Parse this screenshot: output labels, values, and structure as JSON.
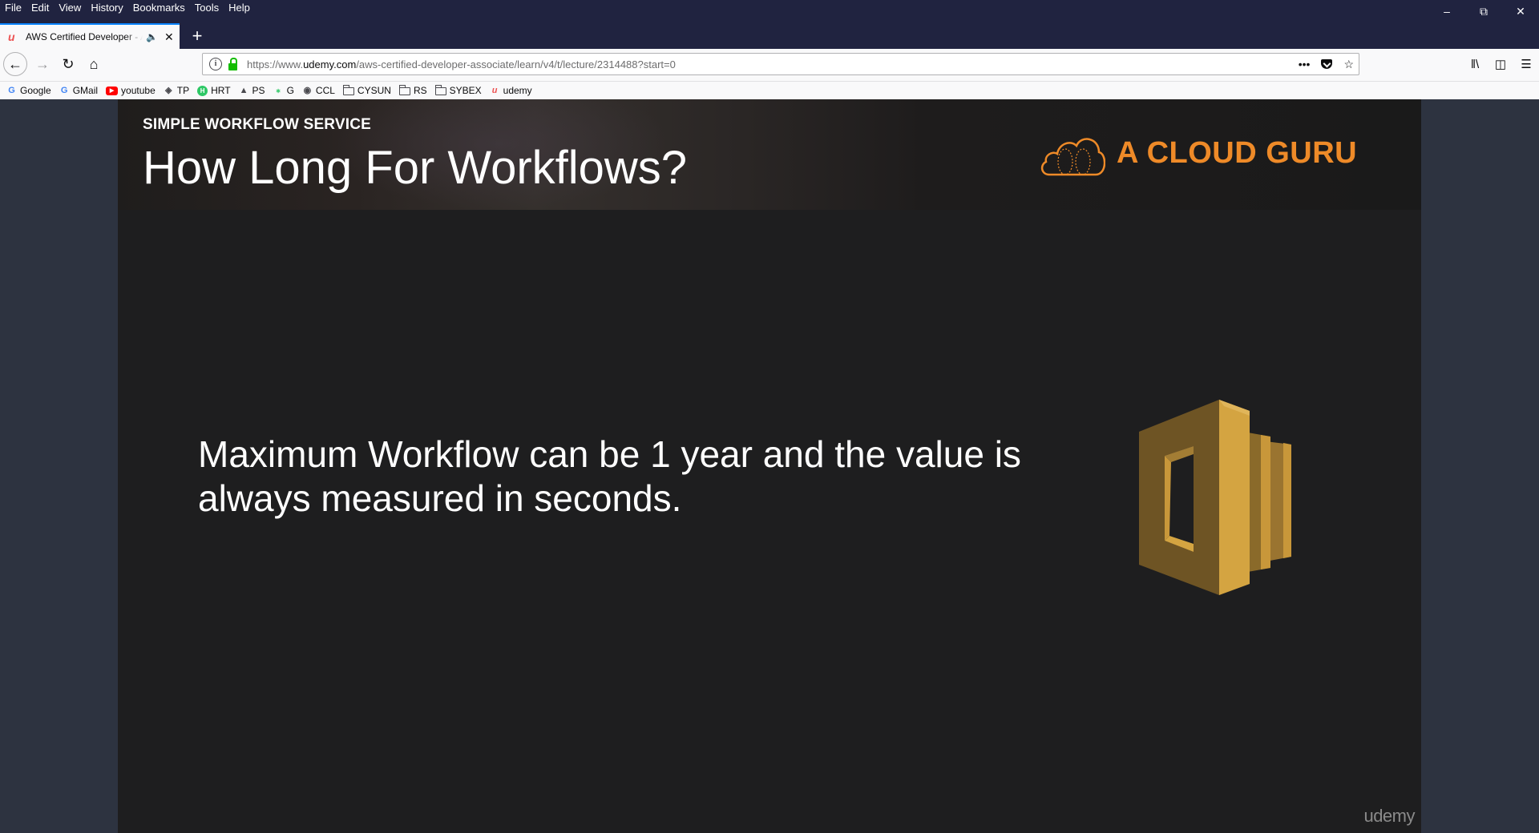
{
  "menu": [
    "File",
    "Edit",
    "View",
    "History",
    "Bookmarks",
    "Tools",
    "Help"
  ],
  "tab": {
    "title": "AWS Certified Developer - Associate",
    "favicon": "udemy-icon"
  },
  "url": {
    "prefix": "https://www.",
    "domain": "udemy.com",
    "path": "/aws-certified-developer-associate/learn/v4/t/lecture/2314488?start=0"
  },
  "bookmarks": [
    {
      "label": "Google",
      "icon": "google-icon"
    },
    {
      "label": "GMail",
      "icon": "google-icon"
    },
    {
      "label": "youtube",
      "icon": "youtube-icon"
    },
    {
      "label": "TP",
      "icon": "tp-icon"
    },
    {
      "label": "HRT",
      "icon": "hackerrank-icon"
    },
    {
      "label": "PS",
      "icon": "ps-icon"
    },
    {
      "label": "G",
      "icon": "g-icon"
    },
    {
      "label": "CCL",
      "icon": "ccl-icon"
    },
    {
      "label": "CYSUN",
      "icon": "folder-icon"
    },
    {
      "label": "RS",
      "icon": "folder-icon"
    },
    {
      "label": "SYBEX",
      "icon": "folder-icon"
    },
    {
      "label": "udemy",
      "icon": "udemy-icon"
    }
  ],
  "slide": {
    "kicker": "SIMPLE WORKFLOW SERVICE",
    "title": "How Long For Workflows?",
    "brand": "A CLOUD GURU",
    "body": "Maximum Workflow can be 1 year and the value is always measured in seconds.",
    "watermark": "udemy"
  },
  "colors": {
    "brand_orange": "#ee8a28",
    "swf_gold": "#c8973a",
    "accent_tab": "#0a84ff"
  }
}
